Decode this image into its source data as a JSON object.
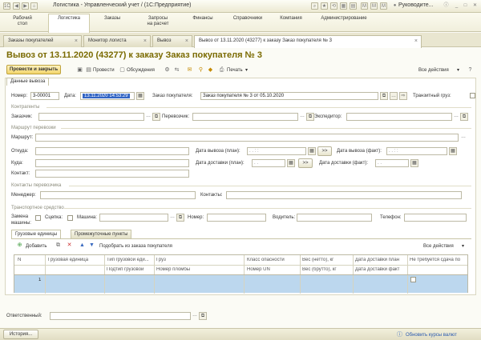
{
  "titlebar": {
    "app_title": "Логистика - Управленческий учет /  (1С:Предприятие)",
    "user": "Руководите..."
  },
  "sections": [
    {
      "label": "Рабочий\nстол"
    },
    {
      "label": "Логистика"
    },
    {
      "label": "Заказы"
    },
    {
      "label": "Запросы\nна расчет"
    },
    {
      "label": "Финансы"
    },
    {
      "label": "Справочники"
    },
    {
      "label": "Компания"
    },
    {
      "label": "Администрирование"
    }
  ],
  "tabs": [
    {
      "label": "Заказы покупателей"
    },
    {
      "label": "Монитор логиста"
    },
    {
      "label": "Вывоз"
    },
    {
      "label": "Вывоз от 13.11.2020 (43277) к заказу  Заказ покупателя № 3"
    }
  ],
  "doc_title": "Вывоз от 13.11.2020 (43277) к заказу  Заказ покупателя № 3",
  "toolbar": {
    "post_close": "Провести и закрыть",
    "post": "Провести",
    "discussions": "Обсуждения",
    "print": "Печать",
    "all_actions": "Все действия"
  },
  "section_tab": "Данные вывоза",
  "fields": {
    "number_label": "Номер:",
    "number": "3-00001",
    "date_label": "Дата:",
    "date": "13.11.2020 14:53:29",
    "order_label": "Заказ покупателя:",
    "order": "Заказ покупателя № 3 от 05.10.2020",
    "transit_label": "Транзитный груз:"
  },
  "contractors": {
    "group": "Контрагенты",
    "customer": "Заказчик:",
    "carrier": "Перевозчик:",
    "forwarder": "Экспедитор:"
  },
  "route": {
    "group": "Маршрут перевозки",
    "route": "Маршрут:",
    "from": "Откуда:",
    "to": "Куда:",
    "contact": "Контакт:",
    "plan_out": "Дата вывоза (план):",
    "fact_out": "Дата вывоза (факт):",
    "plan_in": "Дата доставки (план):",
    "fact_in": "Дата доставки (факт):",
    "date_mask": ". .    :  :",
    "date_mask_short": ". .",
    "arrow": ">>"
  },
  "carrier_contacts": {
    "group": "Контакты перевозчика",
    "manager": "Менеджер:",
    "contacts": "Контакты:"
  },
  "vehicle": {
    "group": "Транспортное средство",
    "replace": "Замена\nмашины:",
    "coupling": "Сцепка:",
    "car": "Машина:",
    "plate": "Номер:",
    "driver": "Водитель:",
    "phone": "Телефон:"
  },
  "subtabs": [
    {
      "label": "Грузовые единицы"
    },
    {
      "label": "Промежуточные пункты"
    }
  ],
  "grid_toolbar": {
    "add": "Добавить",
    "pick": "Подобрать из заказа покупателя",
    "all_actions": "Все действия"
  },
  "grid": {
    "headers_top": [
      "N",
      "Грузовая единица",
      "Тип грузовой еди...",
      "Груз",
      "Класс опасности",
      "Вес (нетто), кг",
      "Дата доставки план",
      "Не требуется сдача по"
    ],
    "headers_bottom": [
      "",
      "",
      "Подтип грузовой",
      "Номер пломбы",
      "Номер UN",
      "Вес (брутто), кг",
      "Дата доставки факт",
      ""
    ],
    "row_number": "1"
  },
  "responsible_label": "Ответственный:",
  "bottom": {
    "history": "История...",
    "update_rates": "Обновить курсы валют"
  }
}
